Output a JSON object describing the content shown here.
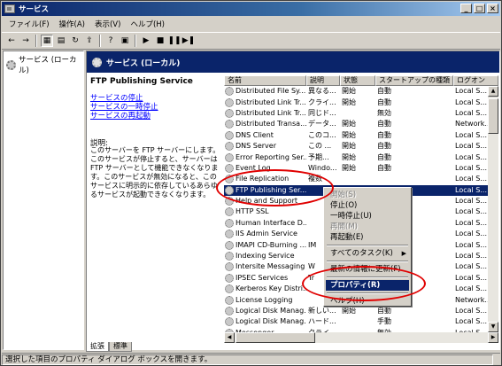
{
  "window": {
    "title": "サービス",
    "buttons": [
      "_",
      "□",
      "×"
    ]
  },
  "menu": [
    "ファイル(F)",
    "操作(A)",
    "表示(V)",
    "ヘルプ(H)"
  ],
  "tree": {
    "root": "サービス (ローカル)"
  },
  "banner": {
    "title": "サービス (ローカル)"
  },
  "detail": {
    "service_name": "FTP Publishing Service",
    "links": [
      "サービスの停止",
      "サービスの一時停止",
      "サービスの再起動"
    ],
    "desc_label": "説明:",
    "desc_text": "このサーバーを FTP サーバーにします。このサービスが停止すると、サーバーは FTP サーバーとして機能できなくなります。このサービスが無効になると、このサービスに明示的に依存しているあらゆるサービスが起動できなくなります。"
  },
  "columns": [
    "名前",
    "説明",
    "状態",
    "スタートアップの種類",
    "ログオン"
  ],
  "services": [
    {
      "name": "Distributed File Sy...",
      "desc": "異なる...",
      "status": "開始",
      "startup": "自動",
      "logon": "Local S..."
    },
    {
      "name": "Distributed Link Tr...",
      "desc": "クライ...",
      "status": "開始",
      "startup": "自動",
      "logon": "Local S..."
    },
    {
      "name": "Distributed Link Tr...",
      "desc": "同じド...",
      "status": "",
      "startup": "無効",
      "logon": "Local S..."
    },
    {
      "name": "Distributed Transa...",
      "desc": "データ...",
      "status": "開始",
      "startup": "自動",
      "logon": "Network..."
    },
    {
      "name": "DNS Client",
      "desc": "このコ...",
      "status": "開始",
      "startup": "自動",
      "logon": "Local S..."
    },
    {
      "name": "DNS Server",
      "desc": "この ...",
      "status": "開始",
      "startup": "自動",
      "logon": "Local S..."
    },
    {
      "name": "Error Reporting Ser...",
      "desc": "予期...",
      "status": "開始",
      "startup": "自動",
      "logon": "Local S..."
    },
    {
      "name": "Event Log",
      "desc": "Windo...",
      "status": "開始",
      "startup": "自動",
      "logon": "Local S..."
    },
    {
      "name": "File Replication",
      "desc": "複数",
      "status": "",
      "startup": "",
      "logon": "Local S..."
    },
    {
      "name": "FTP Publishing Ser...",
      "desc": "",
      "status": "",
      "startup": "",
      "logon": "Local S..."
    },
    {
      "name": "Help and Support",
      "desc": "",
      "status": "",
      "startup": "",
      "logon": "Local S..."
    },
    {
      "name": "HTTP SSL",
      "desc": "",
      "status": "",
      "startup": "",
      "logon": "Local S..."
    },
    {
      "name": "Human Interface D...",
      "desc": "",
      "status": "",
      "startup": "",
      "logon": "Local S..."
    },
    {
      "name": "IIS Admin Service",
      "desc": "",
      "status": "",
      "startup": "",
      "logon": "Local S..."
    },
    {
      "name": "IMAPI CD-Burning ...",
      "desc": "IM",
      "status": "",
      "startup": "",
      "logon": "Local S..."
    },
    {
      "name": "Indexing Service",
      "desc": "",
      "status": "",
      "startup": "",
      "logon": "Local S..."
    },
    {
      "name": "Intersite Messaging",
      "desc": "W",
      "status": "",
      "startup": "",
      "logon": "Local S..."
    },
    {
      "name": "IPSEC Services",
      "desc": "Tr",
      "status": "",
      "startup": "",
      "logon": "Local S..."
    },
    {
      "name": "Kerberos Key Distri...",
      "desc": "",
      "status": "",
      "startup": "",
      "logon": "Local S..."
    },
    {
      "name": "License Logging",
      "desc": "",
      "status": "",
      "startup": "",
      "logon": "Network..."
    },
    {
      "name": "Logical Disk Manag...",
      "desc": "新しい...",
      "status": "開始",
      "startup": "自動",
      "logon": "Local S..."
    },
    {
      "name": "Logical Disk Manag...",
      "desc": "ハード...",
      "status": "",
      "startup": "手動",
      "logon": "Local S..."
    },
    {
      "name": "Messenger",
      "desc": "クライ...",
      "status": "",
      "startup": "無効",
      "logon": "Local S..."
    }
  ],
  "selected_index": 9,
  "context_menu": {
    "items": [
      {
        "label": "開始(S)",
        "disabled": true
      },
      {
        "label": "停止(O)",
        "disabled": false
      },
      {
        "label": "一時停止(U)",
        "disabled": false
      },
      {
        "label": "再開(M)",
        "disabled": true
      },
      {
        "label": "再起動(E)",
        "disabled": false
      },
      {
        "sep": true
      },
      {
        "label": "すべてのタスク(K)",
        "disabled": false,
        "submenu": true
      },
      {
        "sep": true
      },
      {
        "label": "最新の情報に更新(F)",
        "disabled": false
      },
      {
        "sep": true
      },
      {
        "label": "プロパティ(R)",
        "disabled": false,
        "highlighted": true
      },
      {
        "sep": true
      },
      {
        "label": "ヘルプ(H)",
        "disabled": false
      }
    ]
  },
  "tabs": [
    "拡張",
    "標準"
  ],
  "status_text": "選択した項目のプロパティ ダイアログ ボックスを開きます。",
  "colors": {
    "title_start": "#0a246a",
    "selection": "#0a246a",
    "annotation": "#e00000",
    "link": "#0000ff"
  }
}
